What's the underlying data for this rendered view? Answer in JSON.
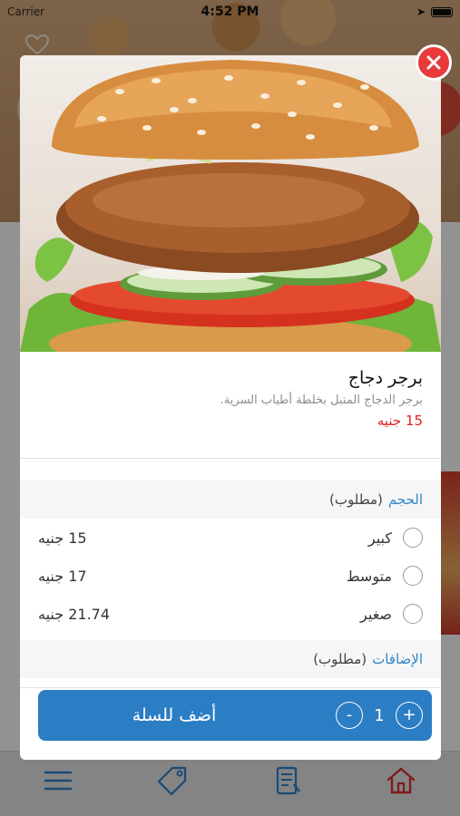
{
  "status_bar": {
    "carrier": "Carrier",
    "time": "4:52 PM"
  },
  "item": {
    "name": "برجر دجاج",
    "description": "برجر الدجاج المتبل بخلطة أطياب السرية.",
    "price": "15 جنيه"
  },
  "size_group": {
    "title": "الحجم",
    "required": "(مطلوب)",
    "options": [
      {
        "name": "كبير",
        "price": "15 جنيه"
      },
      {
        "name": "متوسط",
        "price": "17 جنيه"
      },
      {
        "name": "صغير",
        "price": "21.74 جنيه"
      }
    ]
  },
  "extras_group": {
    "title": "الإضافات",
    "required": "(مطلوب)"
  },
  "cart": {
    "add_label": "أضف للسلة",
    "quantity": "1",
    "plus": "+",
    "minus": "-"
  },
  "colors": {
    "accent": "#2c7ec4",
    "price": "#e02020",
    "close": "#e83a3a"
  },
  "tabbar": {
    "icons": [
      "menu-icon",
      "tag-icon",
      "orders-icon",
      "home-icon"
    ]
  }
}
